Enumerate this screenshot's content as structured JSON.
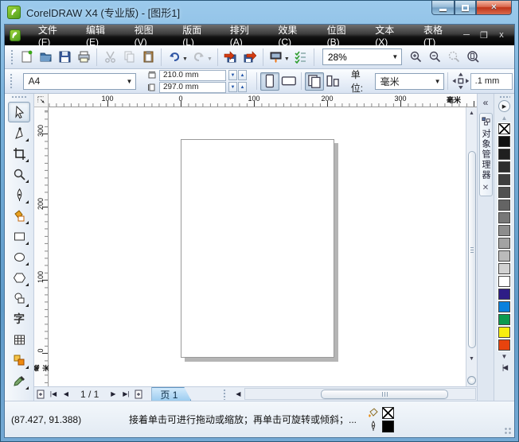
{
  "window": {
    "title": "CorelDRAW X4 (专业版) - [图形1]"
  },
  "menubar": {
    "items": [
      "文件(F)",
      "编辑(E)",
      "视图(V)",
      "版面(L)",
      "排列(A)",
      "效果(C)",
      "位图(B)",
      "文本(X)",
      "表格(T)"
    ]
  },
  "toolbar": {
    "zoom_level": "28%"
  },
  "property_bar": {
    "paper_size": "A4",
    "paper_width": "210.0 mm",
    "paper_height": "297.0 mm",
    "units_label": "单位:",
    "units_value": "毫米",
    "nudge_offset": ".1 mm"
  },
  "rulers": {
    "unit": "毫米",
    "horizontal_labels": [
      "100",
      "0",
      "100",
      "200",
      "300"
    ],
    "vertical_labels": [
      "300",
      "200",
      "100",
      "0"
    ]
  },
  "toolbox": {
    "text_tool_glyph": "字"
  },
  "docker": {
    "tab_title": "对象管理器"
  },
  "palette": {
    "colors": [
      "#111111",
      "#1f1f1f",
      "#2e2e2e",
      "#3f3f3f",
      "#515151",
      "#646464",
      "#787878",
      "#8d8d8d",
      "#a3a3a3",
      "#bababa",
      "#d2d2d2",
      "#ffffff",
      "#2e1d86",
      "#0b81dd",
      "#0d9a4e",
      "#f8ee0f",
      "#e8430e"
    ]
  },
  "navigator": {
    "page_indicator": "1 / 1",
    "page_tab": "页 1"
  },
  "statusbar": {
    "coordinates": "(87.427, 91.388)",
    "hint": "接着单击可进行拖动或缩放；再单击可旋转或倾斜；...",
    "fill_state": "none",
    "outline_color": "#000000"
  }
}
